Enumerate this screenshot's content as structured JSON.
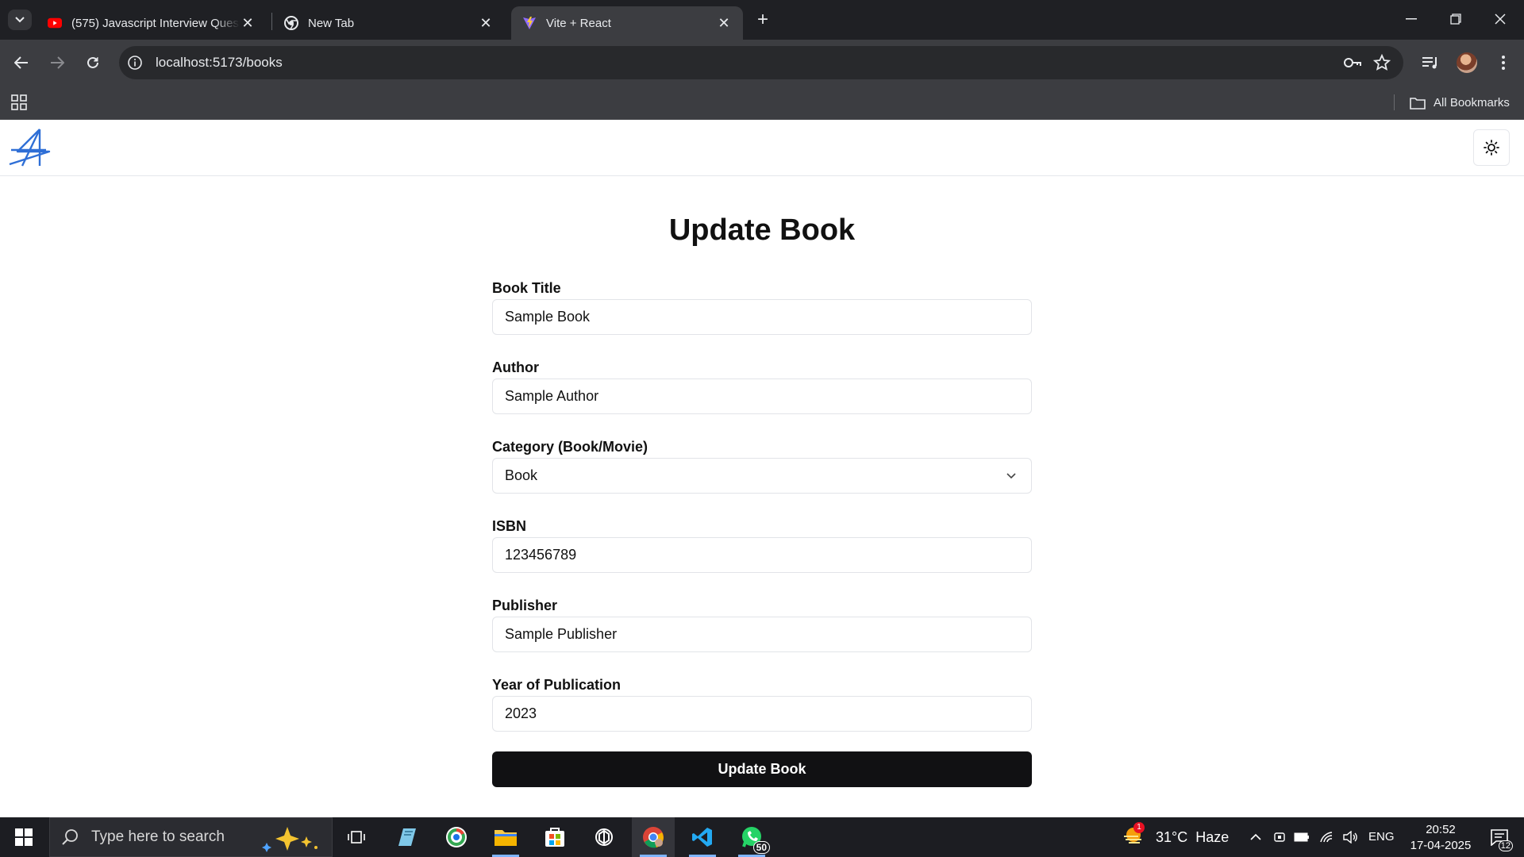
{
  "browser": {
    "tabs": [
      {
        "title": "(575) Javascript Interview Quest",
        "favicon": "youtube-icon"
      },
      {
        "title": "New Tab",
        "favicon": "chrome-icon"
      },
      {
        "title": "Vite + React",
        "favicon": "vite-icon",
        "active": true
      }
    ],
    "url": "localhost:5173/books",
    "all_bookmarks_label": "All Bookmarks"
  },
  "app": {
    "form_title": "Update Book",
    "fields": {
      "title": {
        "label": "Book Title",
        "value": "Sample Book"
      },
      "author": {
        "label": "Author",
        "value": "Sample Author"
      },
      "category": {
        "label": "Category (Book/Movie)",
        "value": "Book"
      },
      "isbn": {
        "label": "ISBN",
        "value": "123456789"
      },
      "publisher": {
        "label": "Publisher",
        "value": "Sample Publisher"
      },
      "year": {
        "label": "Year of Publication",
        "value": "2023"
      }
    },
    "submit_label": "Update Book"
  },
  "taskbar": {
    "search_placeholder": "Type here to search",
    "whatsapp_badge": "50",
    "weather_alert": "1",
    "weather": "31°C  Haze",
    "language": "ENG",
    "time": "20:52",
    "date": "17-04-2025",
    "notifications": "12"
  },
  "colors": {
    "chrome_dark": "#1f2024",
    "toolbar": "#3c3d41",
    "button_dark": "#111113",
    "taskbar": "#1c1d22",
    "accent_blue": "#2f6fd6"
  }
}
